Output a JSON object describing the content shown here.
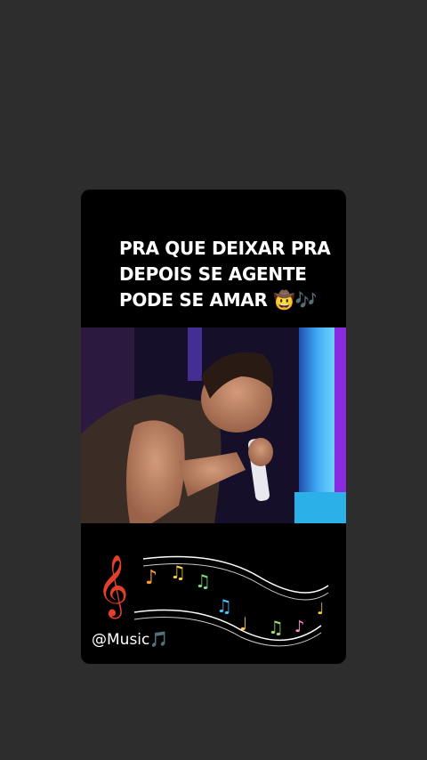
{
  "story": {
    "caption_lines": [
      "PRA QUE DEIXAR PRA",
      "DEPOIS SE AGENTE",
      "PODE SE AMAR 🤠🎶"
    ],
    "sticker_label": "@Music🎵"
  },
  "colors": {
    "background": "#2e2d2d",
    "card": "#000000",
    "stage_blue": "#3fa9f5",
    "stage_purple": "#8a2be2"
  }
}
